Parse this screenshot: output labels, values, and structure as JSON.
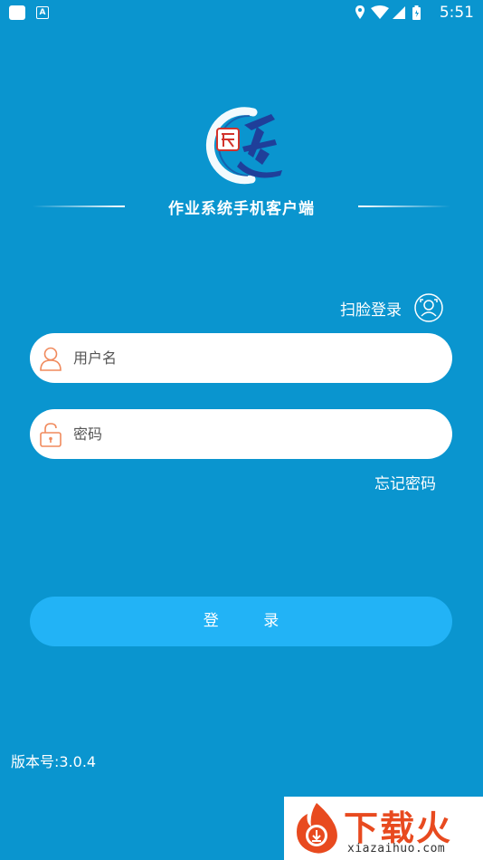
{
  "status_bar": {
    "time": "5:51",
    "notification_letter": "A"
  },
  "app": {
    "title": "作业系统手机客户端"
  },
  "face_login": {
    "label": "扫脸登录"
  },
  "form": {
    "username_placeholder": "用户名",
    "password_placeholder": "密码",
    "forgot_label": "忘记密码",
    "login_label": "登 录"
  },
  "footer": {
    "version": "版本号:3.0.4"
  },
  "watermark": {
    "brand": "下载火",
    "url": "xiazaihuo.com"
  },
  "colors": {
    "background": "#0a95cf",
    "button": "#22b3f6",
    "icon_accent": "#f08a5d",
    "logo_blue": "#1f3f9a",
    "logo_red": "#d2332c"
  }
}
